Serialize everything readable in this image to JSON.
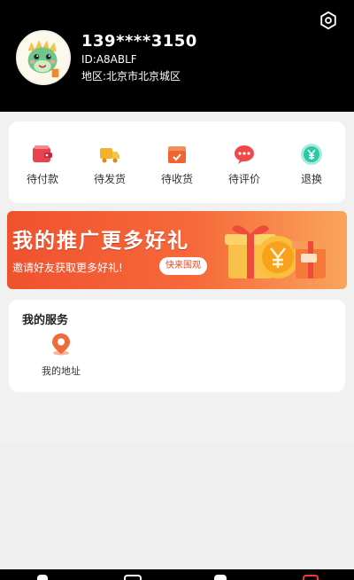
{
  "user": {
    "phone": "139****3150",
    "id_text": "ID:A8ABLF",
    "region_text": "地区:北京市北京城区"
  },
  "orders": {
    "items": [
      {
        "label": "待付款",
        "icon": "wallet-icon",
        "color": "#e9434f"
      },
      {
        "label": "待发货",
        "icon": "truck-icon",
        "color": "#f6b12a"
      },
      {
        "label": "待收货",
        "icon": "box-icon",
        "color": "#f0642f"
      },
      {
        "label": "待评价",
        "icon": "chat-bubble-icon",
        "color": "#f0484a"
      },
      {
        "label": "退换",
        "icon": "yen-icon",
        "color": "#2cc9a5"
      }
    ]
  },
  "promo": {
    "title": "我的推广更多好礼",
    "subtitle": "邀请好友获取更多好礼!",
    "button_label": "快来围观"
  },
  "services": {
    "title": "我的服务",
    "items": [
      {
        "label": "我的地址",
        "icon": "location-pin-icon",
        "color": "#f06a3c"
      }
    ]
  },
  "colors": {
    "header_bg": "#000000",
    "accent": "#f0522e"
  }
}
